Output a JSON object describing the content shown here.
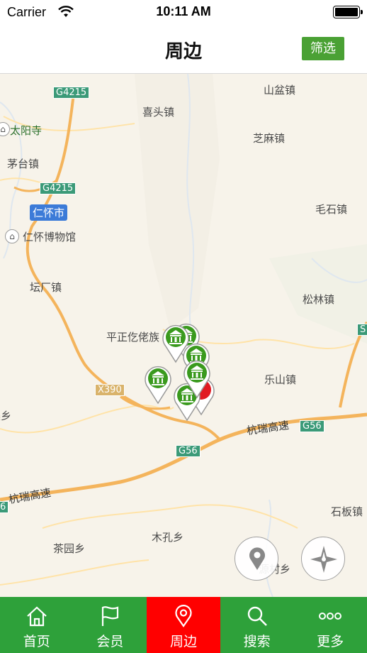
{
  "status_bar": {
    "carrier": "Carrier",
    "time": "10:11 AM"
  },
  "nav": {
    "title": "周边",
    "filter_label": "筛选"
  },
  "map": {
    "places": {
      "shanpen": "山盆镇",
      "xitou": "喜头镇",
      "zhima": "芝麻镇",
      "taiyang": "太阳寺",
      "maotai": "茅台镇",
      "renhuai_city": "仁怀市",
      "museum": "仁怀博物馆",
      "maoshi": "毛石镇",
      "tanchang": "坛厂镇",
      "songlin": "松林镇",
      "pingzheng": "平正仡佬族",
      "leshan": "乐山镇",
      "left_xiang": "渠乡",
      "chayuan": "茶园乡",
      "mukong": "木孔乡",
      "shiban": "石板镇",
      "yuancun": "源村乡",
      "hangrui_1": "杭瑞高速",
      "hangrui_2": "杭瑞高速"
    },
    "shields": {
      "g4215_a": "G4215",
      "g4215_b": "G4215",
      "x390": "X390",
      "g56_a": "G56",
      "g56_b": "G56",
      "s_right": "S",
      "g56_left": "6"
    },
    "markers": [
      "museum-marker",
      "museum-marker",
      "museum-marker",
      "museum-marker",
      "museum-marker",
      "selected-marker"
    ],
    "controls": [
      "location-pin-icon",
      "compass-icon"
    ]
  },
  "tabs": [
    {
      "label": "首页",
      "icon": "home-icon",
      "active": false
    },
    {
      "label": "会员",
      "icon": "flag-icon",
      "active": false
    },
    {
      "label": "周边",
      "icon": "location-icon",
      "active": true
    },
    {
      "label": "搜索",
      "icon": "search-icon",
      "active": false
    },
    {
      "label": "更多",
      "icon": "more-icon",
      "active": false
    }
  ],
  "colors": {
    "tab_bg": "#2ea13a",
    "tab_active": "#ff0000",
    "filter_btn": "#4aa134",
    "marker_green": "#3a9a1e"
  }
}
